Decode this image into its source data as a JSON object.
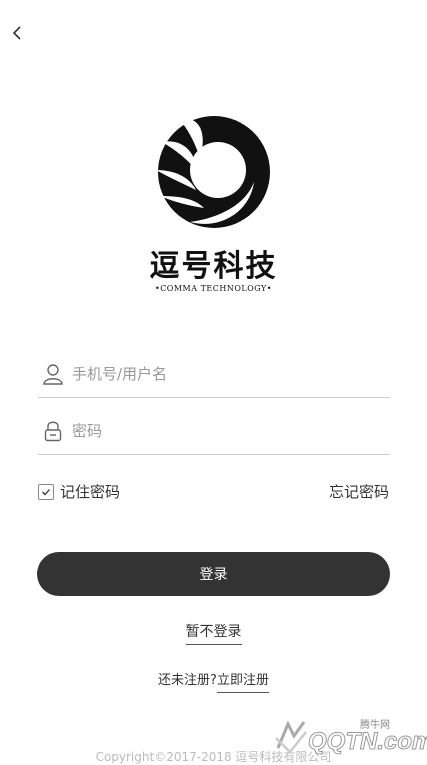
{
  "header": {
    "back_icon": "chevron-left-icon"
  },
  "logo": {
    "name_cn": "逗号科技",
    "name_en": "•COMMA TECHNOLOGY•"
  },
  "form": {
    "username_placeholder": "手机号/用户名",
    "username_value": "",
    "username_icon": "user-icon",
    "password_placeholder": "密码",
    "password_value": "",
    "password_icon": "lock-icon",
    "remember_label": "记住密码",
    "remember_checked": true,
    "forgot_label": "忘记密码",
    "login_label": "登录",
    "skip_label": "暂不登录",
    "register_prompt": "还未注册?",
    "register_link": "立即注册"
  },
  "footer": {
    "copyright": "Copyright©2017-2018 逗号科技有限公司"
  },
  "watermark": {
    "logo_text": "QQTN.com",
    "sub_text": "腾牛网"
  },
  "colors": {
    "primary_dark": "#333333",
    "border": "#cccccc",
    "placeholder": "#999999",
    "background": "#ffffff"
  }
}
